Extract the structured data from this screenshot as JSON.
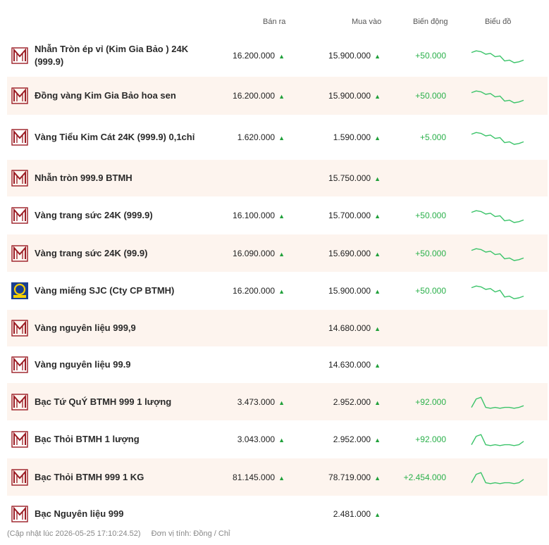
{
  "header": {
    "sell": "Bán ra",
    "buy": "Mua vào",
    "change": "Biến động",
    "chart": "Biểu đồ"
  },
  "colors": {
    "up": "#20a03a",
    "spark": "#3cc46a",
    "alt_row": "#fdf4ee",
    "logo_red": "#9b1c24",
    "sjc_blue": "#1b3f8f",
    "sjc_yellow": "#f6d000"
  },
  "rows": [
    {
      "name": "Nhẫn Tròn ép vỉ (Kim Gia Bảo ) 24K (999.9)",
      "sell": "16.200.000",
      "buy": "15.900.000",
      "change": "+50.000",
      "logo": "btmh-logo",
      "trend": [
        8,
        6,
        7,
        10,
        9,
        13,
        12,
        18,
        17,
        20,
        19,
        17
      ]
    },
    {
      "name": "Đồng vàng Kim Gia Bảo hoa sen",
      "sell": "16.200.000",
      "buy": "15.900.000",
      "change": "+50.000",
      "logo": "btmh-logo",
      "trend": [
        8,
        6,
        7,
        10,
        9,
        13,
        12,
        18,
        17,
        20,
        19,
        17
      ]
    },
    {
      "name": "Vàng Tiểu Kim Cát 24K (999.9) 0,1chỉ",
      "sell": "1.620.000",
      "buy": "1.590.000",
      "change": "+5.000",
      "logo": "btmh-logo",
      "trend": [
        8,
        6,
        7,
        10,
        9,
        13,
        12,
        18,
        17,
        20,
        19,
        17
      ]
    },
    {
      "name": "Nhẫn tròn 999.9 BTMH",
      "sell": "",
      "buy": "15.750.000",
      "change": "",
      "logo": "btmh-logo",
      "trend": []
    },
    {
      "name": "Vàng trang sức 24K (999.9)",
      "sell": "16.100.000",
      "buy": "15.700.000",
      "change": "+50.000",
      "logo": "btmh-logo",
      "trend": [
        8,
        6,
        7,
        10,
        9,
        13,
        12,
        18,
        17,
        20,
        19,
        17
      ]
    },
    {
      "name": "Vàng trang sức 24K (99.9)",
      "sell": "16.090.000",
      "buy": "15.690.000",
      "change": "+50.000",
      "logo": "btmh-logo",
      "trend": [
        8,
        6,
        7,
        10,
        9,
        13,
        12,
        18,
        17,
        20,
        19,
        17
      ]
    },
    {
      "name": "Vàng miếng SJC (Cty CP BTMH)",
      "sell": "16.200.000",
      "buy": "15.900.000",
      "change": "+50.000",
      "logo": "sjc-logo",
      "trend": [
        8,
        6,
        7,
        10,
        9,
        13,
        11,
        19,
        18,
        21,
        20,
        18
      ]
    },
    {
      "name": "Vàng nguyên liệu 999,9",
      "sell": "",
      "buy": "14.680.000",
      "change": "",
      "logo": "btmh-logo",
      "trend": []
    },
    {
      "name": "Vàng nguyên liệu 99.9",
      "sell": "",
      "buy": "14.630.000",
      "change": "",
      "logo": "btmh-logo",
      "trend": []
    },
    {
      "name": "Bạc Tứ QuÝ BTMH 999 1 lượng",
      "sell": "3.473.000",
      "buy": "2.952.000",
      "change": "+92.000",
      "logo": "btmh-logo",
      "trend": [
        18,
        8,
        6,
        18,
        19,
        18,
        19,
        18,
        18,
        19,
        18,
        16
      ]
    },
    {
      "name": "Bạc Thỏi BTMH 1 lượng",
      "sell": "3.043.000",
      "buy": "2.952.000",
      "change": "+92.000",
      "logo": "btmh-logo",
      "trend": [
        18,
        8,
        6,
        18,
        19,
        18,
        19,
        18,
        18,
        19,
        18,
        14
      ]
    },
    {
      "name": "Bạc Thỏi BTMH 999 1 KG",
      "sell": "81.145.000",
      "buy": "78.719.000",
      "change": "+2.454.000",
      "logo": "btmh-logo",
      "trend": [
        18,
        8,
        6,
        18,
        19,
        18,
        19,
        18,
        18,
        19,
        18,
        14
      ]
    },
    {
      "name": "Bạc Nguyên liệu 999",
      "sell": "",
      "buy": "2.481.000",
      "change": "",
      "logo": "btmh-logo",
      "trend": []
    }
  ],
  "footer": {
    "updated": "(Cập nhật lúc 2026-05-25 17:10:24.52)",
    "unit": "Đơn vị tính: Đồng / Chỉ"
  }
}
